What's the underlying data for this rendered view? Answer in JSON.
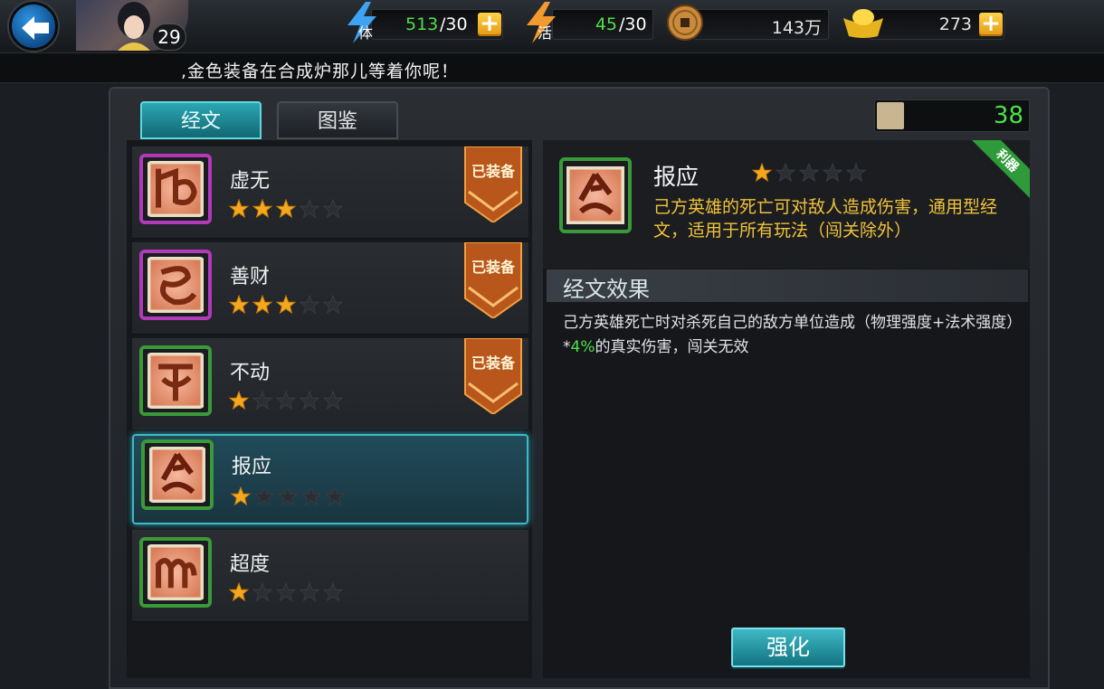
{
  "header": {
    "player_level": "29",
    "stamina": {
      "label": "体",
      "value": "513",
      "max": "/30"
    },
    "vitality": {
      "label": "活",
      "value": "45",
      "max": "/30"
    },
    "coins": "143万",
    "gold": "273"
  },
  "ticker": ",金色装备在合成炉那儿等着你呢！",
  "tabs": [
    {
      "label": "经文",
      "active": true
    },
    {
      "label": "图鉴",
      "active": false
    }
  ],
  "fragment_count": "38",
  "list": {
    "equipped_label": "已装备",
    "items": [
      {
        "name": "虚无",
        "stars": 3,
        "max_stars": 5,
        "equipped": true,
        "quality": "purple",
        "glyph": "rune-xuwu"
      },
      {
        "name": "善财",
        "stars": 3,
        "max_stars": 5,
        "equipped": true,
        "quality": "purple",
        "glyph": "rune-shancai"
      },
      {
        "name": "不动",
        "stars": 1,
        "max_stars": 5,
        "equipped": true,
        "quality": "green",
        "glyph": "rune-budong"
      },
      {
        "name": "报应",
        "stars": 1,
        "max_stars": 5,
        "equipped": false,
        "quality": "green",
        "glyph": "rune-baoying",
        "selected": true
      },
      {
        "name": "超度",
        "stars": 1,
        "max_stars": 5,
        "equipped": false,
        "quality": "green",
        "glyph": "rune-chaodu"
      }
    ]
  },
  "detail": {
    "name": "报应",
    "stars": 1,
    "max_stars": 5,
    "ribbon": "利器",
    "description": "己方英雄的死亡可对敌人造成伤害，通用型经文，适用于所有玩法（闯关除外）",
    "section_title": "经文效果",
    "effect_prefix": "己方英雄死亡时对杀死自己的敌方单位造成（物理强度+法术强度）*",
    "effect_highlight": "4%",
    "effect_suffix": "的真实伤害，闯关无效",
    "upgrade_label": "强化"
  },
  "colors": {
    "accent": "#3fb9c6",
    "value_green": "#4ce04a",
    "desc_gold": "#f2c23a",
    "quality_purple": "#b03ab9",
    "quality_green": "#3a9a3a"
  }
}
